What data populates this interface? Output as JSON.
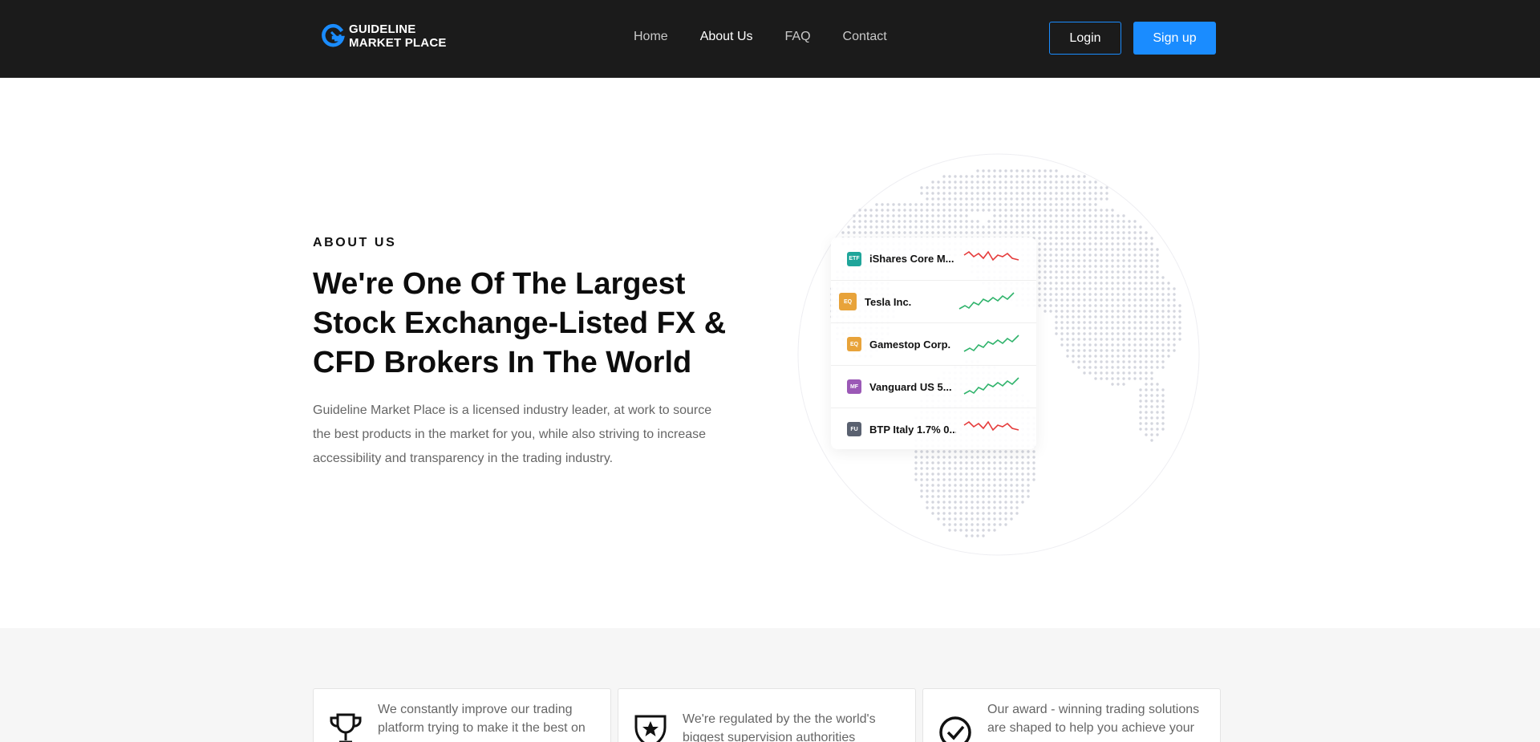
{
  "header": {
    "logo_line1": "GUIDELINE",
    "logo_line2": "MARKET PLACE",
    "nav": [
      "Home",
      "About Us",
      "FAQ",
      "Contact"
    ],
    "active_nav": "About Us",
    "login_label": "Login",
    "signup_label": "Sign up"
  },
  "hero": {
    "eyebrow": "ABOUT US",
    "title": "We're One Of The Largest Stock Exchange-Listed FX & CFD Brokers In The World",
    "description": "Guideline Market Place is a licensed industry leader, at work to source the best products in the market for you, while also striving to increase accessibility and transparency in the trading industry."
  },
  "tickers": [
    {
      "badge": "ETF",
      "name": "iShares Core M...",
      "color": "#1fa59a",
      "trend": "down"
    },
    {
      "badge": "EQ",
      "name": "Tesla Inc.",
      "color": "#e8a33a",
      "trend": "up"
    },
    {
      "badge": "EQ",
      "name": "Gamestop Corp.",
      "color": "#e8a33a",
      "trend": "up"
    },
    {
      "badge": "MF",
      "name": "Vanguard US 5...",
      "color": "#9b59b6",
      "trend": "up"
    },
    {
      "badge": "FU",
      "name": "BTP Italy 1.7% 0...",
      "color": "#5a6170",
      "trend": "down"
    }
  ],
  "features": [
    {
      "icon": "trophy-icon",
      "text": "We constantly improve our trading platform trying to make it the best on"
    },
    {
      "icon": "shield-star-icon",
      "text": "We're regulated by the the world's biggest supervision authorities"
    },
    {
      "icon": "check-circle-icon",
      "text": "Our award - winning trading solutions are shaped to help you achieve your"
    }
  ],
  "colors": {
    "accent": "#1a8cff",
    "header_bg": "#1b1b1b",
    "up": "#2fb36b",
    "down": "#e53b3b"
  }
}
